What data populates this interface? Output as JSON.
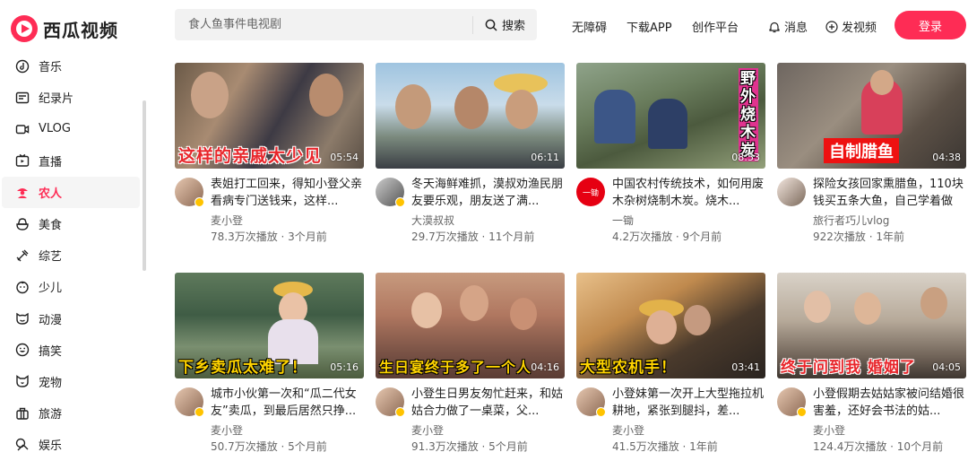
{
  "app": {
    "name": "西瓜视频",
    "brand_color": "#fe2c55"
  },
  "search": {
    "placeholder": "食人鱼事件电视剧",
    "button_label": "搜索"
  },
  "header": {
    "links": [
      "无障碍",
      "下载APP",
      "创作平台"
    ],
    "messages_label": "消息",
    "upload_label": "发视频",
    "login_label": "登录"
  },
  "sidebar": {
    "items": [
      {
        "label": "音乐",
        "icon": "music-icon"
      },
      {
        "label": "纪录片",
        "icon": "documentary-icon"
      },
      {
        "label": "VLOG",
        "icon": "vlog-icon"
      },
      {
        "label": "直播",
        "icon": "live-icon"
      },
      {
        "label": "农人",
        "icon": "farmer-icon",
        "active": true
      },
      {
        "label": "美食",
        "icon": "food-icon"
      },
      {
        "label": "综艺",
        "icon": "variety-icon"
      },
      {
        "label": "少儿",
        "icon": "kids-icon"
      },
      {
        "label": "动漫",
        "icon": "anime-icon"
      },
      {
        "label": "搞笑",
        "icon": "funny-icon"
      },
      {
        "label": "宠物",
        "icon": "pet-icon"
      },
      {
        "label": "旅游",
        "icon": "travel-icon"
      },
      {
        "label": "娱乐",
        "icon": "entertainment-icon"
      }
    ]
  },
  "videos": [
    {
      "caption": "这样的亲戚太少见",
      "duration": "05:54",
      "title": "表姐打工回来，得知小登父亲看病专门送钱来，这样...",
      "author": "麦小登",
      "stats": "78.3万次播放 · 3个月前"
    },
    {
      "caption": "",
      "duration": "06:11",
      "title": "冬天海鲜难抓，漠叔劝渔民朋友要乐观，朋友送了满...",
      "author": "大漠叔叔",
      "stats": "29.7万次播放 · 11个月前"
    },
    {
      "caption": "野外烧木炭",
      "duration": "08:53",
      "title": "中国农村传统技术，如何用废木杂树烧制木炭。烧木...",
      "author": "一锄",
      "avatar_text": "一锄",
      "stats": "4.2万次播放 · 9个月前"
    },
    {
      "caption": "自制腊鱼",
      "duration": "04:38",
      "title": "探险女孩回家熏腊鱼，110块钱买五条大鱼，自己学着做",
      "author": "旅行者巧儿vlog",
      "stats": "922次播放 · 1年前"
    },
    {
      "caption": "下乡卖瓜太难了！",
      "duration": "05:16",
      "title": "城市小伙第一次和“瓜二代女友”卖瓜，到最后居然只挣...",
      "author": "麦小登",
      "stats": "50.7万次播放 · 5个月前"
    },
    {
      "caption": "生日宴终于多了一个人",
      "duration": "04:16",
      "title": "小登生日男友匆忙赶来，和姑姑合力做了一桌菜，父...",
      "author": "麦小登",
      "stats": "91.3万次播放 · 5个月前"
    },
    {
      "caption": "大型农机手！",
      "duration": "03:41",
      "title": "小登妹第一次开上大型拖拉机耕地，紧张到腿抖，差...",
      "author": "麦小登",
      "stats": "41.5万次播放 · 1年前"
    },
    {
      "caption": "终于问到我 婚姻了",
      "duration": "04:05",
      "title": "小登假期去姑姑家被问结婚很害羞，还好会书法的姑...",
      "author": "麦小登",
      "stats": "124.4万次播放 · 10个月前"
    }
  ]
}
